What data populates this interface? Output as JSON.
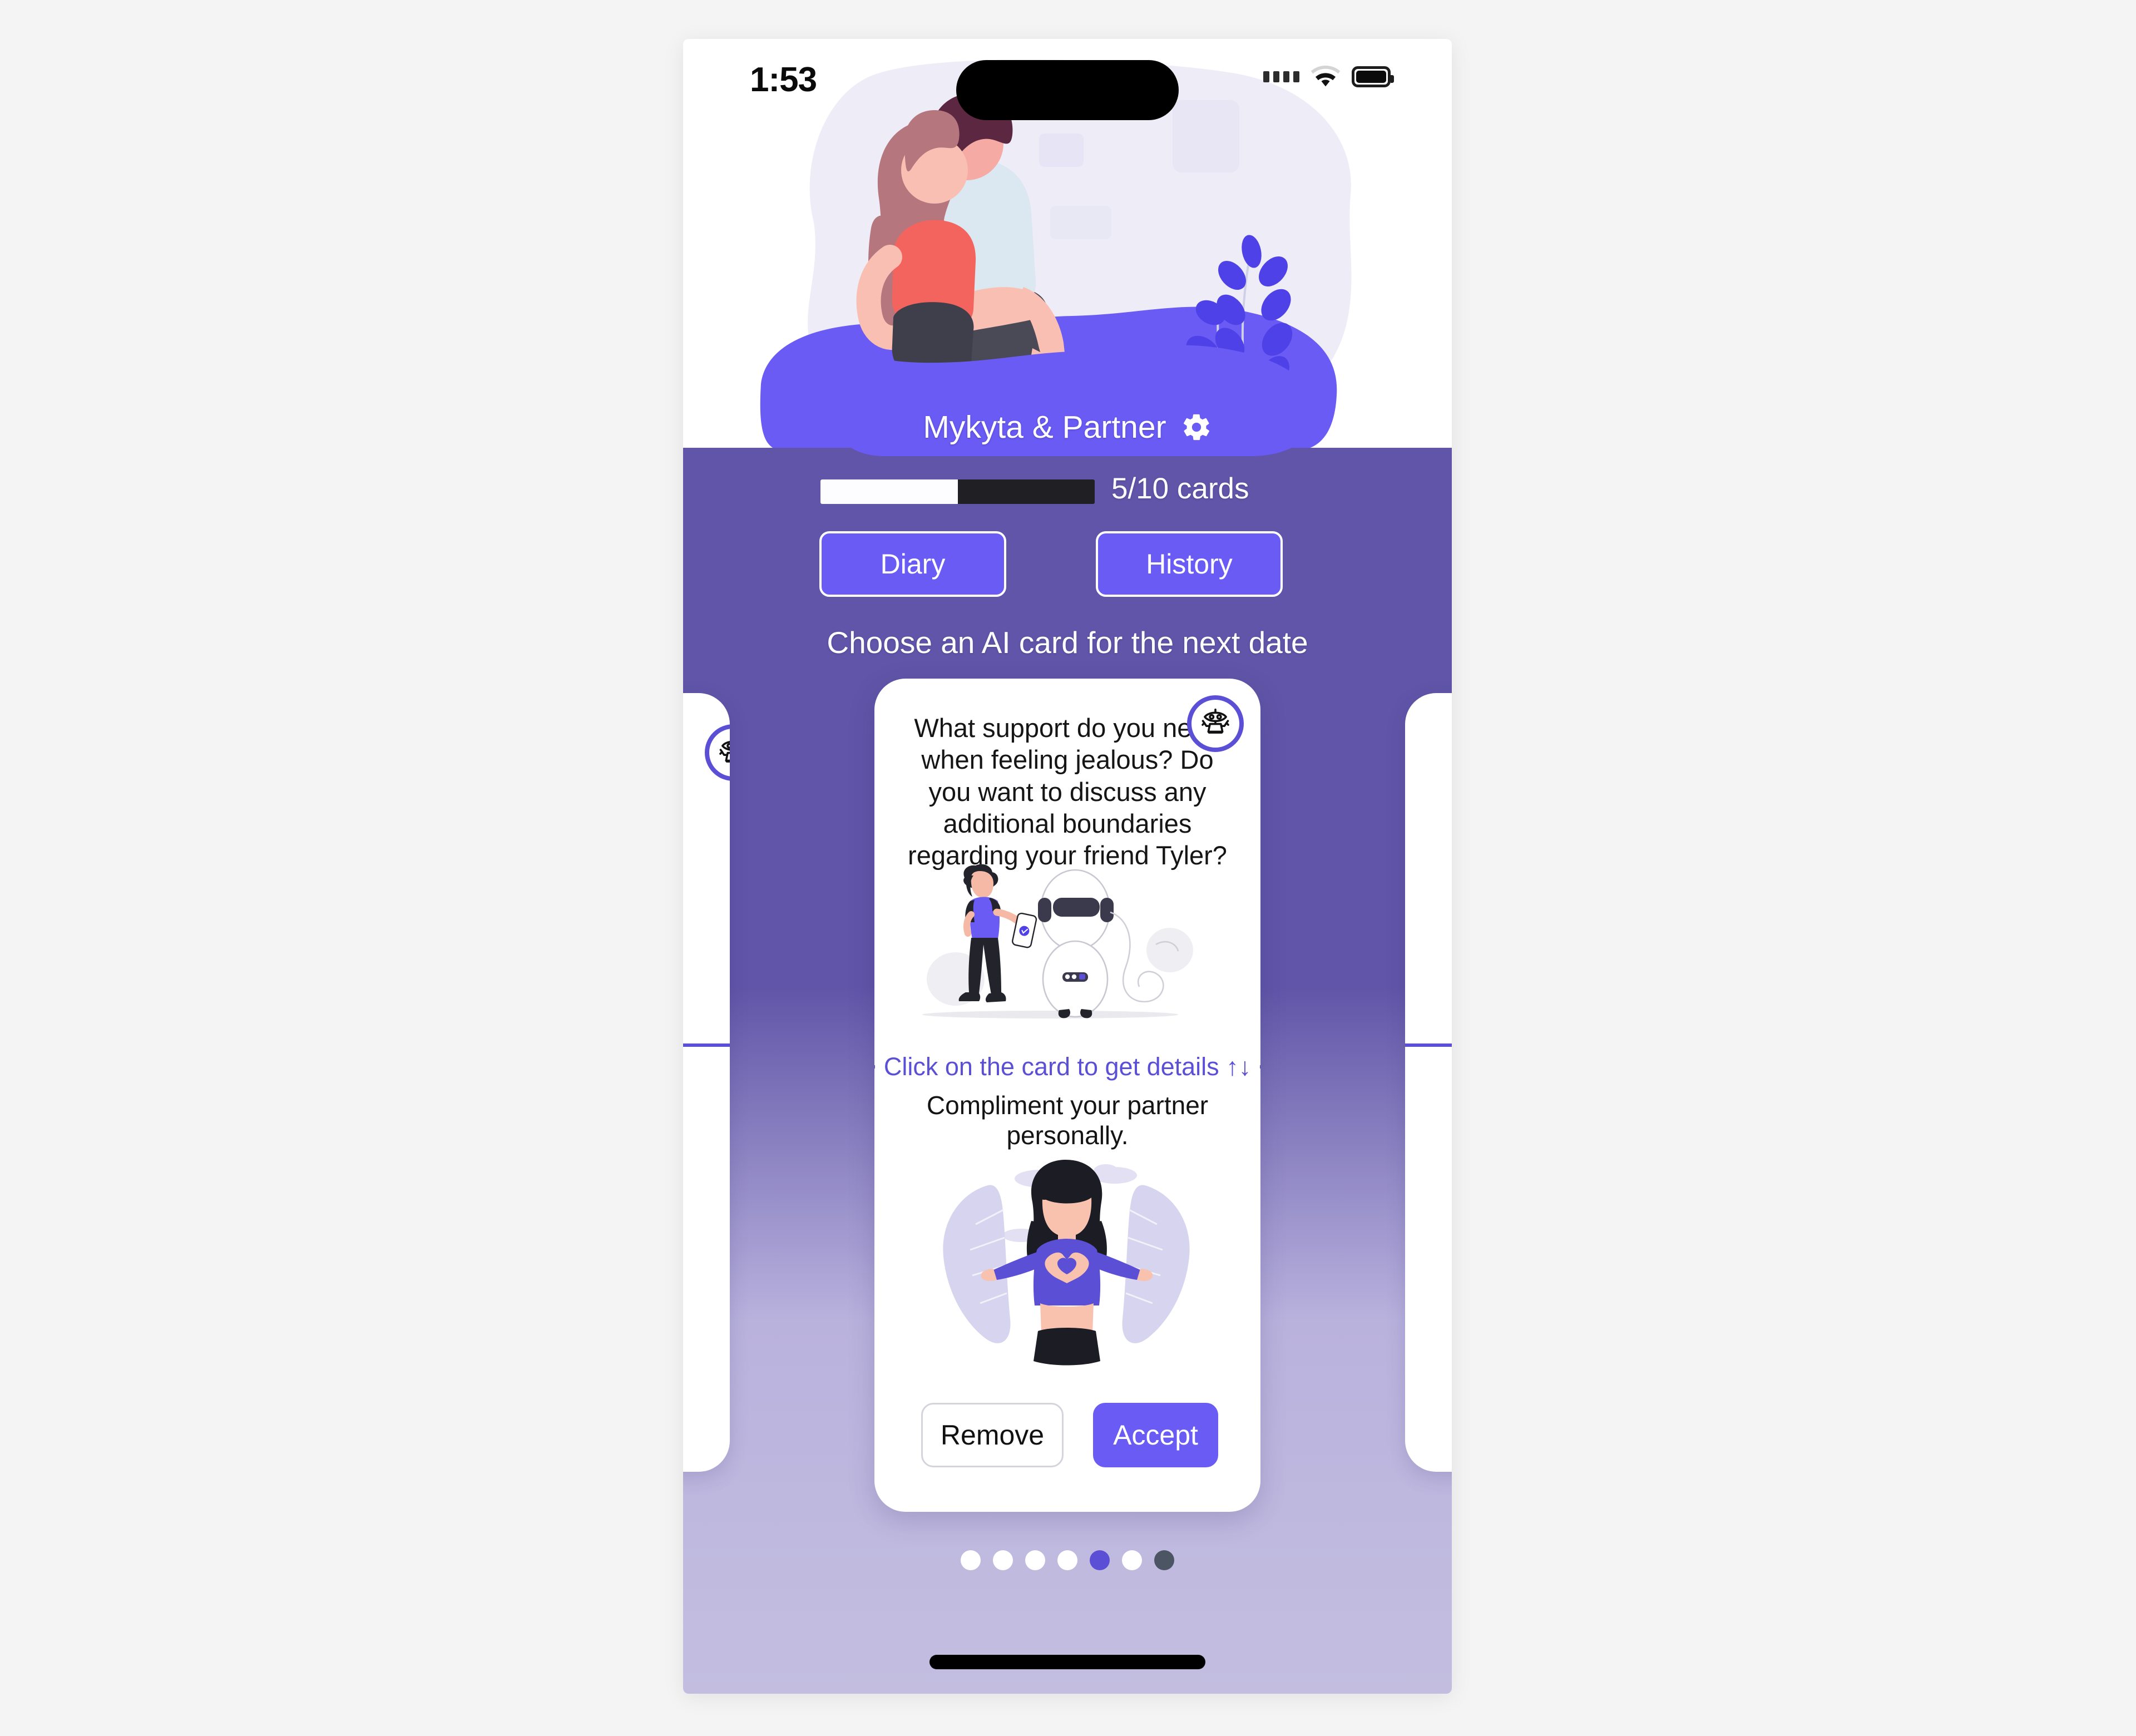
{
  "status_bar": {
    "time": "1:53",
    "signal_icon": "signal-dots-icon",
    "wifi_icon": "wifi-icon",
    "battery_icon": "battery-icon"
  },
  "hero": {
    "illustration": "couple-sitting-illustration"
  },
  "header": {
    "couple_title": "Mykyta & Partner",
    "settings_icon": "gear-icon",
    "progress": {
      "label": "5/10 cards",
      "current": 5,
      "total": 10,
      "percent": 50
    },
    "buttons": [
      {
        "label": "Diary",
        "name": "diary-button"
      },
      {
        "label": "History",
        "name": "history-button"
      }
    ],
    "section_title": "Choose an AI card for the next date",
    "background_color": "#6055a8",
    "accent_color": "#6a5bf5"
  },
  "card": {
    "badge_icon": "robot-icon",
    "question": "What support do you need when feeling jealous? Do you want to discuss any additional boundaries regarding your friend Tyler?",
    "question_illustration": "person-with-phone-and-robot-illustration",
    "hint": "Click on the card to get details ↑↓",
    "hint_color": "#5b4fd6",
    "subtitle": "Compliment your partner personally.",
    "subtitle_illustration": "woman-making-heart-hands-illustration",
    "actions": {
      "remove_label": "Remove",
      "accept_label": "Accept",
      "accept_color": "#6a5bf5"
    }
  },
  "pagination": {
    "total": 7,
    "active_index": 4,
    "dots": [
      "white",
      "white",
      "white",
      "white",
      "active",
      "white",
      "dark"
    ]
  },
  "system": {
    "home_indicator": "home-indicator"
  }
}
